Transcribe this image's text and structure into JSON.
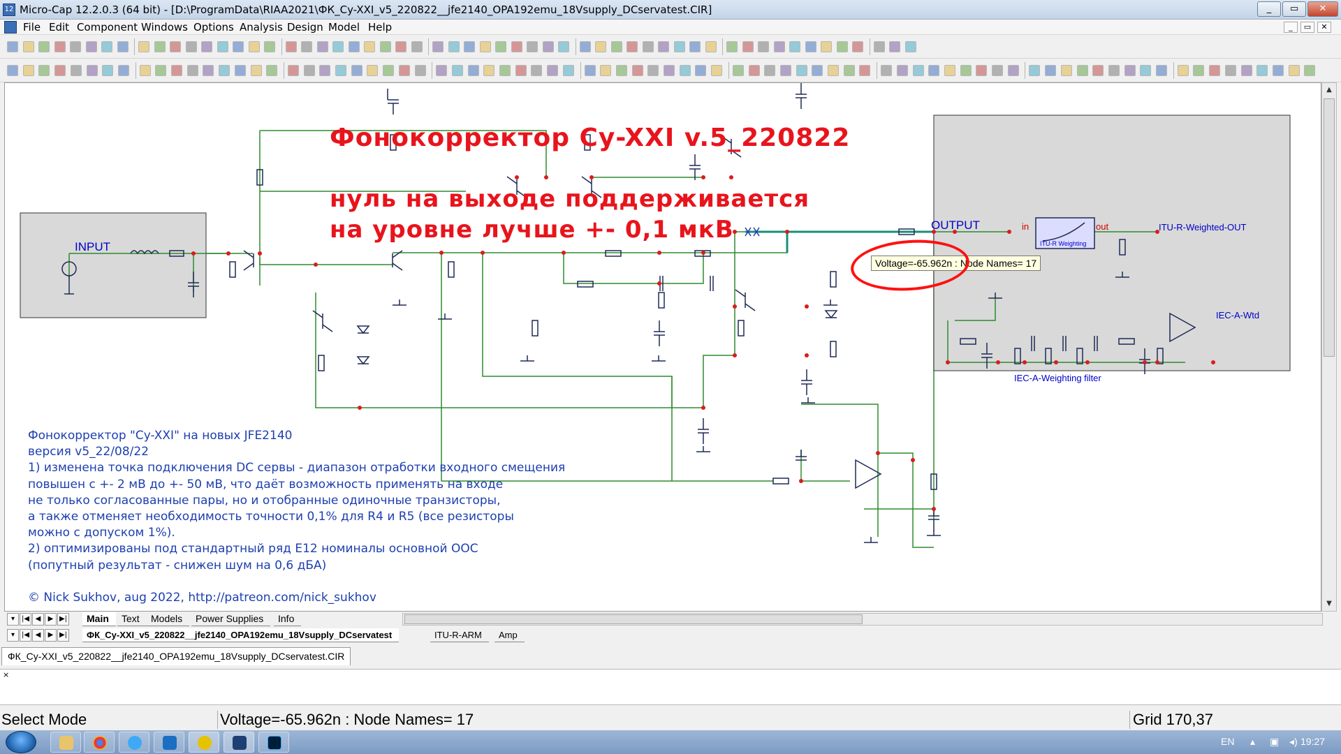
{
  "window": {
    "title": "Micro-Cap 12.2.0.3 (64 bit) - [D:\\ProgramData\\RIAA2021\\ФК_Cy-XXI_v5_220822__jfe2140_OPA192emu_18Vsupply_DCservatest.CIR]",
    "app_icon": "12",
    "min": "_",
    "restore": "▭",
    "close": "✕"
  },
  "menu": [
    "File",
    "Edit",
    "Component",
    "Windows",
    "Options",
    "Analysis",
    "Design",
    "Model",
    "Help"
  ],
  "mdi_buttons": [
    "_",
    "▭",
    "✕"
  ],
  "annotations": {
    "title": "Фонокорректор Cy-XXI v.5_220822",
    "line1": "нуль на выходе поддерживается",
    "line2": "на уровне лучше +- 0,1 мкВ",
    "color": "#e8141c"
  },
  "schematic": {
    "input_label": "INPUT",
    "output_label": "OUTPUT",
    "itu_block_label": "ITU-R Weighting",
    "itu_in": "in",
    "itu_out": "out",
    "itu_out_label": "ITU-R-Weighted-OUT",
    "iec_out_label": "IEC-A-Wtd",
    "iec_filter_label": "IEC-A-Weighting filter",
    "wire_color": "#2e8b2e",
    "node_color": "#d91d1d",
    "label_color": "#0000c8"
  },
  "tooltip": "Voltage=-65.962n : Node Names= 17",
  "notes": [
    "Фонокорректор \"Cy-XXI\" на новых JFE2140",
    "версия v5_22/08/22",
    "1) изменена точка подключения DC сервы - диапазон отработки входного смещения",
    "повышен с +- 2 мВ до +- 50 мВ, что даёт возможность применять на входе",
    "не только согласованные пары, но и отобранные одиночные транзисторы,",
    "а также отменяет необходимость точности 0,1% для R4 и R5 (все резисторы",
    "можно с допуском 1%).",
    "2) оптимизированы под стандартный ряд E12 номиналы основной ООС",
    "(попутный результат - снижен шум на 0,6 дБА)",
    "",
    "© Nick Sukhov, aug 2022, http://patreon.com/nick_sukhov"
  ],
  "page_tabs": [
    "Main",
    "Text",
    "Models",
    "Power Supplies",
    "Info"
  ],
  "circuit_tabs": [
    "ФК_Cy-XXI_v5_220822__jfe2140_OPA192emu_18Vsupply_DCservatest",
    "ITU-R-ARM",
    "Amp"
  ],
  "nav_glyphs": [
    "▾",
    "|◀",
    "◀",
    "▶",
    "▶|"
  ],
  "document_tab": "ФК_Cy-XXI_v5_220822__jfe2140_OPA192emu_18Vsupply_DCservatest.CIR",
  "command_close": "×",
  "status": {
    "mode": "Select Mode",
    "message": "Voltage=-65.962n : Node Names= 17",
    "grid": "Grid 170,37"
  },
  "taskbar": {
    "lang": "EN",
    "time": "19:27",
    "apps": [
      "folder-icon",
      "chrome-icon",
      "ie-icon",
      "store-icon",
      "microcap-icon",
      "save-icon",
      "photoshop-icon"
    ]
  }
}
